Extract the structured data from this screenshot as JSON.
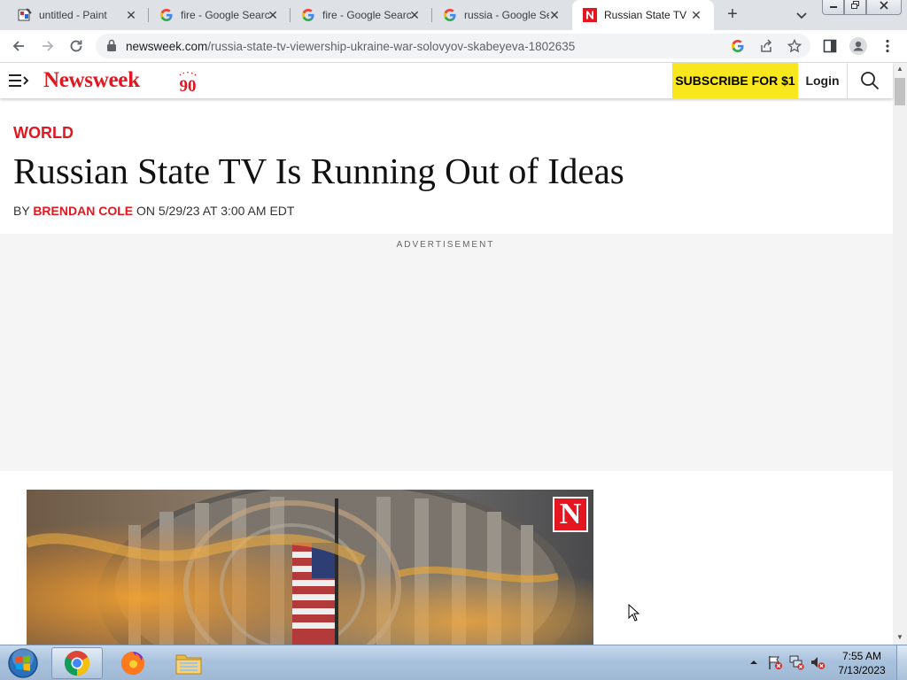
{
  "browser": {
    "tabs": [
      {
        "title": "untitled - Paint",
        "icon": "paint-icon"
      },
      {
        "title": "fire - Google Search",
        "icon": "google-icon"
      },
      {
        "title": "fire - Google Search",
        "icon": "google-icon"
      },
      {
        "title": "russia - Google Search",
        "icon": "google-icon"
      },
      {
        "title": "Russian State TV Is Running Out of Ideas",
        "icon": "newsweek-icon",
        "active": true
      }
    ],
    "new_tab_symbol": "+",
    "address": {
      "domain": "newsweek.com",
      "path": "/russia-state-tv-viewership-ukraine-war-solovyov-skabeyeva-1802635"
    }
  },
  "site": {
    "logo_text": "Newsweek",
    "logo_badge": "90",
    "subscribe_label": "SUBSCRIBE FOR $1",
    "login_label": "Login"
  },
  "article": {
    "section": "WORLD",
    "headline": "Russian State TV Is Running Out of Ideas",
    "byline_prefix": "BY ",
    "author": "BRENDAN COLE",
    "byline_suffix": " ON 5/29/23 AT 3:00 AM EDT",
    "ad_label": "ADVERTISEMENT",
    "image_badge": "N"
  },
  "taskbar": {
    "apps": [
      "chrome-icon",
      "firefox-icon",
      "file-explorer-icon"
    ],
    "clock_time": "7:55 AM",
    "clock_date": "7/13/2023"
  },
  "colors": {
    "brand_red": "#e4161f",
    "subscribe_yellow": "#f8e71c",
    "tabstrip": "#dee1e6"
  }
}
